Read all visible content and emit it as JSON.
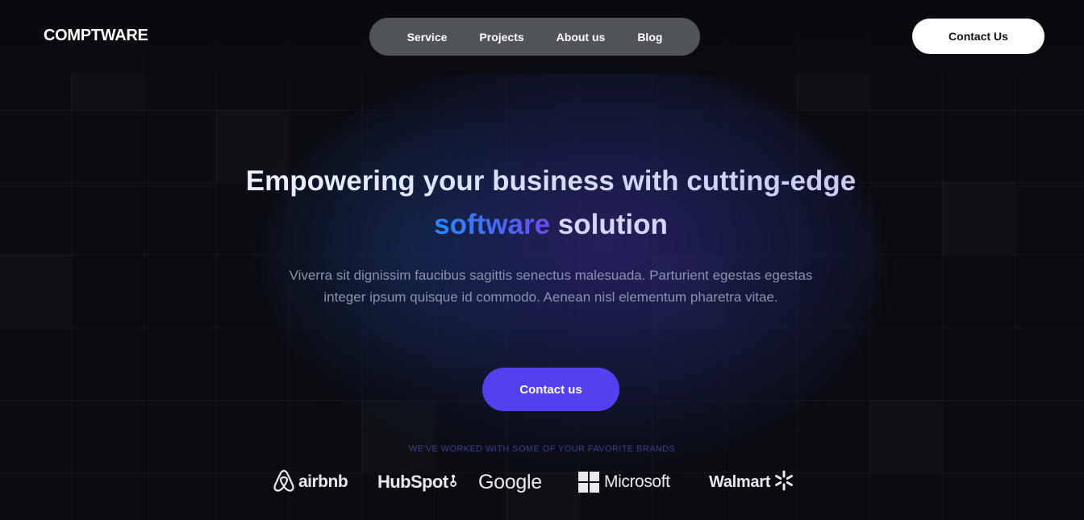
{
  "header": {
    "logo": "COMPTWARE",
    "nav": [
      {
        "label": "Service"
      },
      {
        "label": "Projects"
      },
      {
        "label": "About us"
      },
      {
        "label": "Blog"
      }
    ],
    "cta_label": "Contact Us"
  },
  "hero": {
    "title_pre": "Empowering your business with cutting-edge",
    "title_accent": "software",
    "title_post": "solution",
    "subtitle": "Viverra sit dignissim faucibus sagittis senectus malesuada. Parturient egestas egestas integer ipsum quisque id commodo. Aenean nisl elementum pharetra vitae.",
    "cta_label": "Contact us"
  },
  "brands": {
    "caption": "WE'VE WORKED WITH SOME OF YOUR FAVORITE BRANDS",
    "items": [
      {
        "name": "airbnb",
        "icon": "airbnb-logo-icon"
      },
      {
        "name": "HubSpot",
        "icon": "hubspot-logo-icon"
      },
      {
        "name": "Google",
        "icon": "google-logo-icon"
      },
      {
        "name": "Microsoft",
        "icon": "microsoft-logo-icon"
      },
      {
        "name": "Walmart",
        "icon": "walmart-spark-icon"
      }
    ]
  },
  "colors": {
    "background": "#0b0c11",
    "nav_pill": "#505358",
    "primary_button": "#5340ee",
    "accent_gradient_start": "#1f8cff",
    "accent_gradient_end": "#6a4cf5",
    "subtitle": "#8b92ad",
    "caption": "#3a3f8e"
  }
}
